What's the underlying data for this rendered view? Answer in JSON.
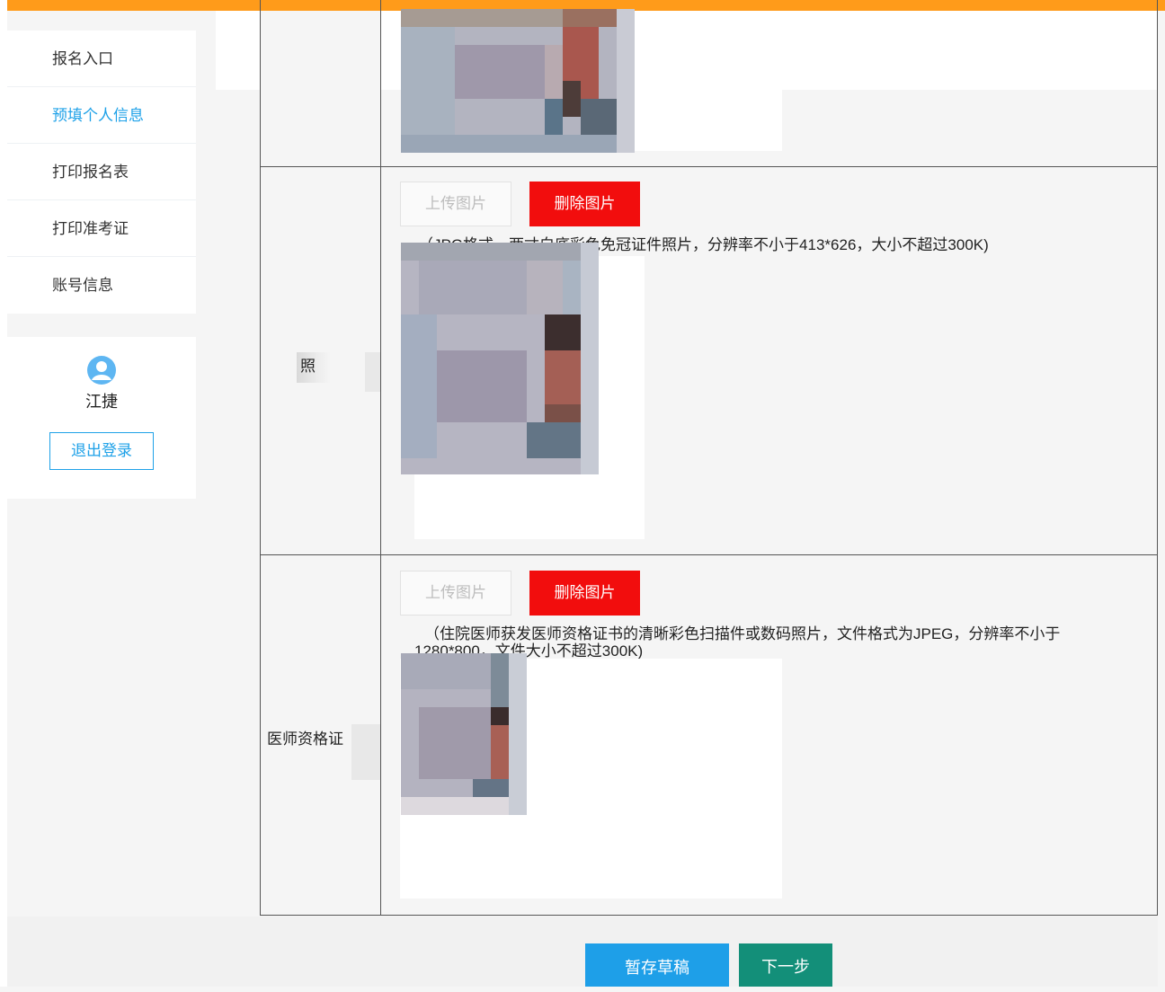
{
  "sidebar": {
    "items": [
      {
        "label": "报名入口"
      },
      {
        "label": "预填个人信息"
      },
      {
        "label": "打印报名表"
      },
      {
        "label": "打印准考证"
      },
      {
        "label": "账号信息"
      }
    ],
    "active_color": "#1ea1e8"
  },
  "user": {
    "name": "江捷",
    "logout_label": "退出登录"
  },
  "form": {
    "rows": [
      {
        "photo_uploaded": true
      },
      {
        "label": "照",
        "upload_label": "上传图片",
        "delete_label": "删除图片",
        "hint": "（JPG格式，两寸白底彩色免冠证件照片，分辨率不小于413*626，大小不超过300K)"
      },
      {
        "label": "医师资格证",
        "upload_label": "上传图片",
        "delete_label": "删除图片",
        "hint_line1": "（住院医师获发医师资格证书的清晰彩色扫描件或数码照片，文件格式为JPEG，分辨率不小于",
        "hint_line2": "1280*800，文件大小不超过300K)"
      }
    ]
  },
  "footer": {
    "draft_label": "暂存草稿",
    "next_label": "下一步"
  },
  "colors": {
    "topbar": "#ff9b1a",
    "delete": "#f20d0d",
    "draft": "#1e9fe8",
    "next": "#138f79"
  }
}
